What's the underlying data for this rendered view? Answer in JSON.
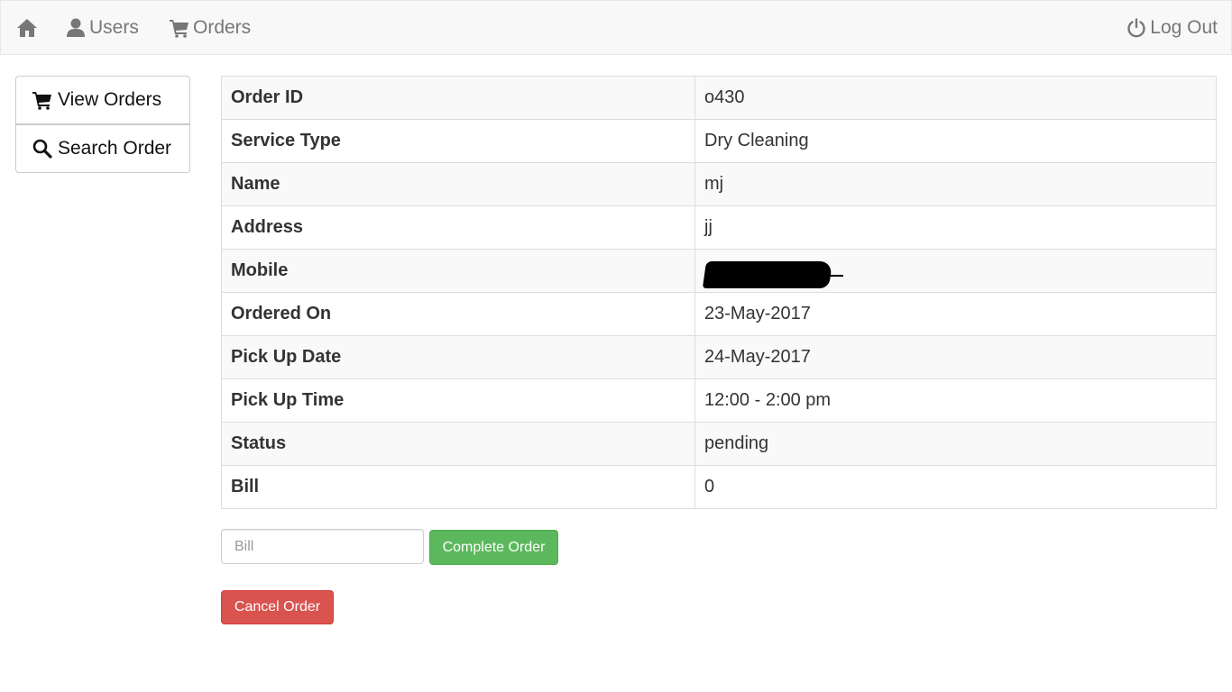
{
  "navbar": {
    "home_icon": "home-icon",
    "users_label": "Users",
    "users_icon": "user-icon",
    "orders_label": "Orders",
    "orders_icon": "cart-icon",
    "logout_label": "Log Out",
    "logout_icon": "power-icon"
  },
  "sidebar": {
    "items": [
      {
        "label": "View Orders",
        "icon": "cart-icon"
      },
      {
        "label": "Search Order",
        "icon": "search-icon"
      }
    ]
  },
  "order": {
    "rows": [
      {
        "label": "Order ID",
        "value": "o430"
      },
      {
        "label": "Service Type",
        "value": "Dry Cleaning"
      },
      {
        "label": "Name",
        "value": "mj"
      },
      {
        "label": "Address",
        "value": "jj"
      },
      {
        "label": "Mobile",
        "value": "",
        "redacted": true
      },
      {
        "label": "Ordered On",
        "value": "23-May-2017"
      },
      {
        "label": "Pick Up Date",
        "value": "24-May-2017"
      },
      {
        "label": "Pick Up Time",
        "value": "12:00 - 2:00 pm"
      },
      {
        "label": "Status",
        "value": "pending"
      },
      {
        "label": "Bill",
        "value": "0"
      }
    ]
  },
  "form": {
    "bill_placeholder": "Bill",
    "bill_value": "",
    "complete_label": "Complete Order",
    "cancel_label": "Cancel Order"
  },
  "colors": {
    "navbar_bg": "#f8f8f8",
    "success": "#5cb85c",
    "danger": "#d9534f",
    "stripe": "#f9f9f9"
  }
}
